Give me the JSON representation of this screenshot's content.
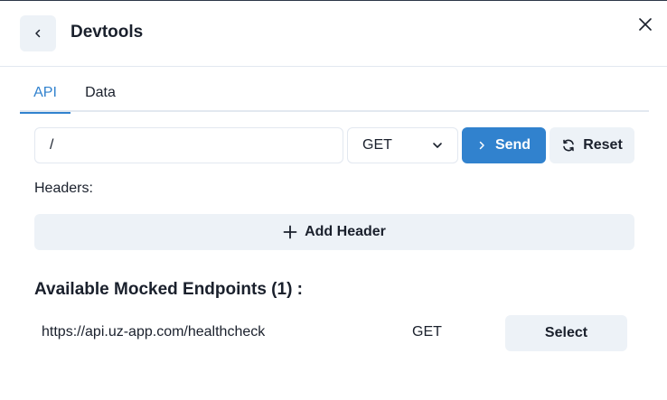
{
  "header": {
    "title": "Devtools"
  },
  "tabs": [
    {
      "label": "API",
      "active": true
    },
    {
      "label": "Data",
      "active": false
    }
  ],
  "request": {
    "url_value": "/",
    "method": "GET",
    "send_label": "Send",
    "reset_label": "Reset"
  },
  "headers": {
    "label": "Headers:",
    "add_label": "Add Header"
  },
  "endpoints": {
    "title": "Available Mocked Endpoints (1) :",
    "items": [
      {
        "url": "https://api.uz-app.com/healthcheck",
        "method": "GET",
        "select_label": "Select"
      }
    ]
  },
  "colors": {
    "accent": "#3182ce",
    "button_bg": "#edf2f7",
    "border": "#e2e8f0",
    "text": "#1a202c"
  },
  "icons": {
    "back": "chevron-left-icon",
    "close": "close-icon",
    "select": "chevron-down-icon",
    "send": "chevron-right-icon",
    "reset": "refresh-icon",
    "add": "plus-icon"
  }
}
